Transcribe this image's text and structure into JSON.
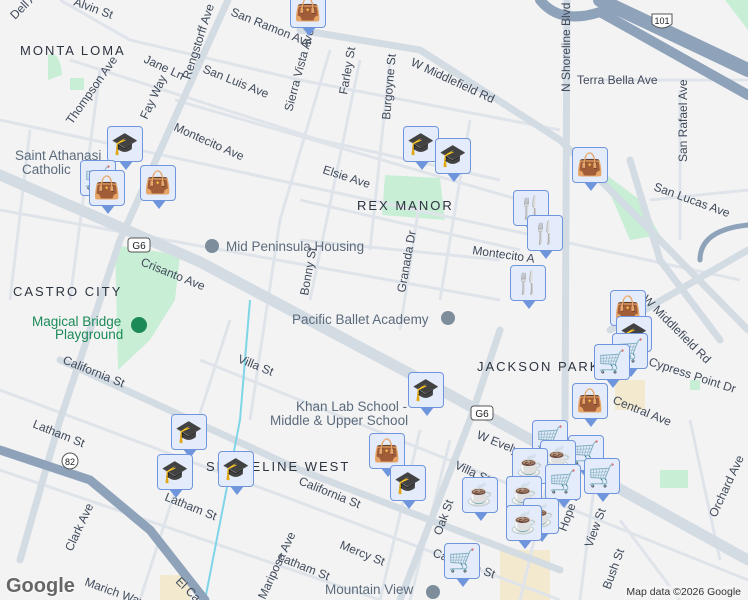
{
  "neighborhoods": {
    "monta_loma": "MONTA LOMA",
    "rex_manor": "REX MANOR",
    "castro_city": "CASTRO CITY",
    "jackson_park": "JACKSON PARK",
    "shoreline_west": "SHORELINE WEST"
  },
  "pois": {
    "mid_peninsula": "Mid Peninsula Housing",
    "pacific_ballet": "Pacific Ballet Academy",
    "magical_bridge_1": "Magical Bridge",
    "magical_bridge_2": "Playground",
    "khan_1": "Khan Lab School -",
    "khan_2": "Middle & Upper School",
    "saint_1": "Saint Athanasi",
    "saint_2": "Catholic",
    "mv_library": "Mountain View"
  },
  "streets": {
    "alvin": "Alvin St",
    "dell": "Dell Av",
    "rengstorff": "Rengstorff Ave",
    "san_ramon": "San Ramon Ave",
    "middlefield": "W Middlefield Rd",
    "middlefield2": "W Middlefield Rd",
    "jane": "Jane Ln",
    "san_luis": "San Luis Ave",
    "fay": "Fay Way",
    "thompson": "Thompson Ave",
    "sierra_vista": "Sierra Vista Ave",
    "farley": "Farley St",
    "burgoyne": "Burgoyne St",
    "montecito": "Montecito Ave",
    "montecito2": "Montecito A",
    "elsie": "Elsie Ave",
    "crisanto": "Crisanto Ave",
    "bonny": "Bonny St",
    "granada": "Granada Dr",
    "shoreline": "N Shoreline Blvd",
    "terra_bella": "Terra Bella Ave",
    "san_rafael": "San Rafael Ave",
    "san_lucas": "San Lucas Ave",
    "cypress": "Cypress Point Dr",
    "central": "Central Ave",
    "orchard": "Orchard Ave",
    "villa": "Villa St",
    "villa2": "Villa St",
    "california": "California St",
    "california2": "California St",
    "california3": "California St",
    "latham": "Latham St",
    "latham2": "Latham St",
    "latham3": "Latham St",
    "clark": "Clark Ave",
    "mercy": "Mercy St",
    "marich": "Marich Way",
    "mariposa": "Mariposa Ave",
    "evelyn": "W Evelyn",
    "oak": "Oak St",
    "hope": "Hope St",
    "view": "View St",
    "bush": "Bush St",
    "el_camino": "El Ca"
  },
  "shields": {
    "g6": "G6",
    "us101": "101",
    "sr82": "82"
  },
  "footer": {
    "logo": "Google",
    "attribution": "Map data ©2026 Google"
  },
  "colors": {
    "marker_fill": "#e4ecfb",
    "marker_border": "#6f95dc",
    "icon": "#0b4168",
    "park": "#c9eed6"
  }
}
